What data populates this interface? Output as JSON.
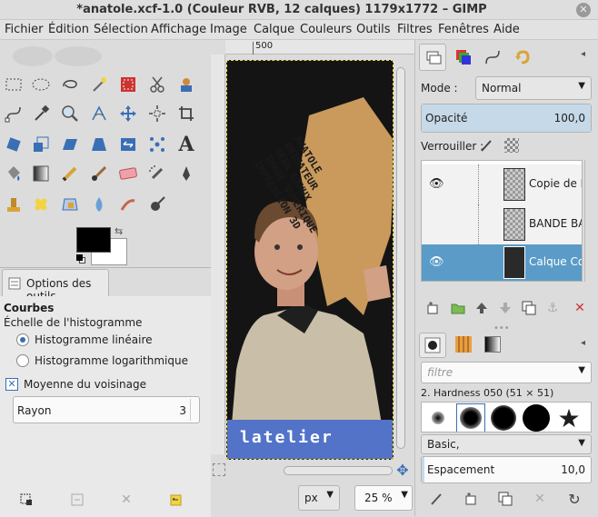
{
  "window": {
    "title": "*anatole.xcf-1.0 (Couleur RVB, 12 calques) 1179x1772 – GIMP",
    "close": "✕"
  },
  "menu": [
    "Fichier",
    "Édition",
    "Sélection",
    "Affichage",
    "Image",
    "Calque",
    "Couleurs",
    "Outils",
    "Filtres",
    "Fenêtres",
    "Aide"
  ],
  "tool_options": {
    "tab": "Options des outils",
    "tool_name": "Courbes",
    "scale_label": "Échelle de l'histogramme",
    "radio_linear": "Histogramme linéaire",
    "radio_log": "Histogramme logarithmique",
    "average_label": "Moyenne du voisinage",
    "radius_label": "Rayon",
    "radius_value": "3"
  },
  "ruler": {
    "mark": "500"
  },
  "canvas": {
    "sign_text": [
      "ANATOLE",
      "ANIMATEUR",
      "GEEK LINUX",
      "IMAGE NUMÉRIQUE",
      "IMPRESSION 3D"
    ],
    "banner": "latelier"
  },
  "statusbar": {
    "unit": "px",
    "zoom": "25 %"
  },
  "layers": {
    "mode_label": "Mode :",
    "mode_value": "Normal",
    "opacity_label": "Opacité",
    "opacity_value": "100,0",
    "opacity_fraction": 1.0,
    "lock_label": "Verrouiller :",
    "items": [
      {
        "name": "Copie de BA",
        "visible": true,
        "selected": false
      },
      {
        "name": "BANDE BASS",
        "visible": false,
        "selected": false
      },
      {
        "name": "Calque Copi",
        "visible": true,
        "selected": true
      }
    ]
  },
  "brushes": {
    "filter_placeholder": "filtre",
    "brush_name": "2. Hardness 050 (51 × 51)",
    "preset": "Basic,",
    "spacing_label": "Espacement",
    "spacing_value": "10,0",
    "spacing_fraction": 0.1
  },
  "colors": {
    "selection_blue": "#5b9bc8",
    "banner_blue": "#5273c8",
    "sign_brown": "#c99a5c"
  }
}
